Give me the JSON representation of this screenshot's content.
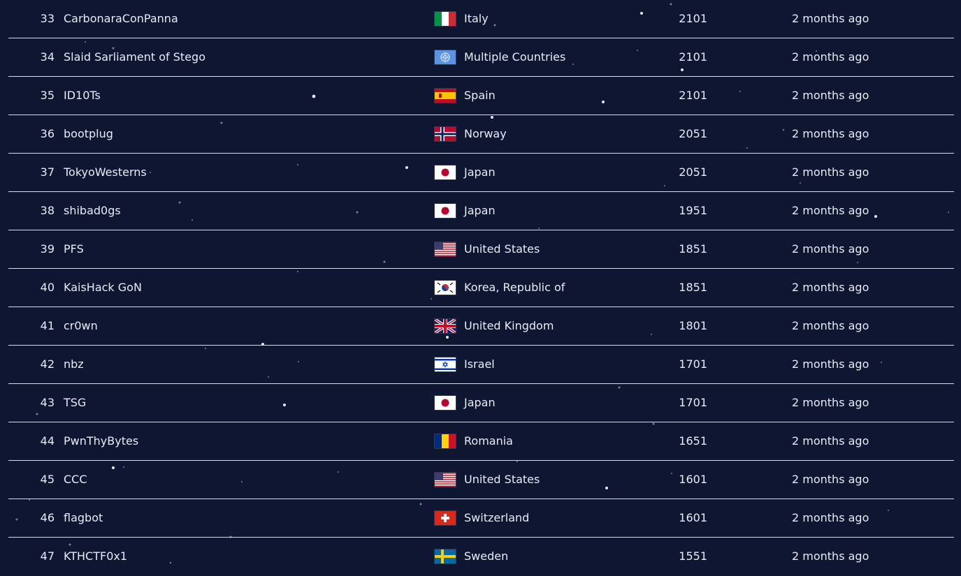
{
  "scoreboard": {
    "rows": [
      {
        "rank": "33",
        "team": "CarbonaraConPanna",
        "country": "Italy",
        "flag": "italy-flag-icon",
        "points": "2101",
        "time": "2 months ago"
      },
      {
        "rank": "34",
        "team": "Slaid Sarliament of Stego",
        "country": "Multiple Countries",
        "flag": "un-flag-icon",
        "points": "2101",
        "time": "2 months ago"
      },
      {
        "rank": "35",
        "team": "ID10Ts",
        "country": "Spain",
        "flag": "spain-flag-icon",
        "points": "2101",
        "time": "2 months ago"
      },
      {
        "rank": "36",
        "team": "bootplug",
        "country": "Norway",
        "flag": "norway-flag-icon",
        "points": "2051",
        "time": "2 months ago"
      },
      {
        "rank": "37",
        "team": "TokyoWesterns",
        "country": "Japan",
        "flag": "japan-flag-icon",
        "points": "2051",
        "time": "2 months ago"
      },
      {
        "rank": "38",
        "team": "shibad0gs",
        "country": "Japan",
        "flag": "japan-flag-icon",
        "points": "1951",
        "time": "2 months ago"
      },
      {
        "rank": "39",
        "team": "PFS",
        "country": "United States",
        "flag": "usa-flag-icon",
        "points": "1851",
        "time": "2 months ago"
      },
      {
        "rank": "40",
        "team": "KaisHack GoN",
        "country": "Korea, Republic of",
        "flag": "korea-flag-icon",
        "points": "1851",
        "time": "2 months ago"
      },
      {
        "rank": "41",
        "team": "cr0wn",
        "country": "United Kingdom",
        "flag": "uk-flag-icon",
        "points": "1801",
        "time": "2 months ago"
      },
      {
        "rank": "42",
        "team": "nbz",
        "country": "Israel",
        "flag": "israel-flag-icon",
        "points": "1701",
        "time": "2 months ago"
      },
      {
        "rank": "43",
        "team": "TSG",
        "country": "Japan",
        "flag": "japan-flag-icon",
        "points": "1701",
        "time": "2 months ago"
      },
      {
        "rank": "44",
        "team": "PwnThyBytes",
        "country": "Romania",
        "flag": "romania-flag-icon",
        "points": "1651",
        "time": "2 months ago"
      },
      {
        "rank": "45",
        "team": "CCC",
        "country": "United States",
        "flag": "usa-flag-icon",
        "points": "1601",
        "time": "2 months ago"
      },
      {
        "rank": "46",
        "team": "flagbot",
        "country": "Switzerland",
        "flag": "switzerland-flag-icon",
        "points": "1601",
        "time": "2 months ago"
      },
      {
        "rank": "47",
        "team": "KTHCTF0x1",
        "country": "Sweden",
        "flag": "sweden-flag-icon",
        "points": "1551",
        "time": "2 months ago"
      }
    ]
  },
  "colors": {
    "background": "#0f1632",
    "text": "#e8ecf6",
    "divider": "#d7dce8",
    "star": "#ffffff"
  }
}
